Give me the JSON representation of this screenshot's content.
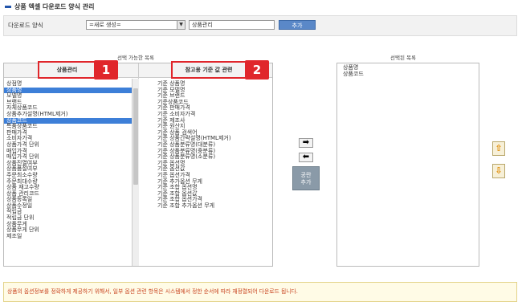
{
  "page": {
    "title": "상품 엑셀 다운로드 양식 관리"
  },
  "form": {
    "label": "다운로드 양식",
    "select_value": "=새로 생성=",
    "name_value": "상품관리",
    "add_label": "추가"
  },
  "available": {
    "label": "선택 가능한 목록",
    "col1_header": "상품관리",
    "col2_header": "참고용 기준 값 관련",
    "col1_items": [
      "상점명",
      "상품명",
      "모델명",
      "브랜드",
      "자체상품코드",
      "상품추가설명(HTML제거)",
      "상품코드",
      "특품상품코드",
      "판매가격",
      "소비자가격",
      "상품가격 단위",
      "매입가격",
      "매입가격 단위",
      "상품진열여부",
      "상품품절여부",
      "주문최소수량",
      "주문최대수량",
      "상품 재고수량",
      "상품 관리코드",
      "상품등록일",
      "상품수정일",
      "적립금",
      "적립금 단위",
      "상품무게",
      "상품무게 단위",
      "제조일"
    ],
    "col1_selected": [
      1,
      6
    ],
    "col2_items": [
      "기준 상품명",
      "기준 모델명",
      "기준 브랜드",
      "기준상품코드",
      "기준 판매가격",
      "기준 소비자가격",
      "기준 제조사",
      "기준 원산지",
      "기준 상품 검색어",
      "기준 상품간략설명(HTML제거)",
      "기준 상품분류명(대분류)",
      "기준 상품분류명(중분류)",
      "기준 상품분류명(소분류)",
      "기준 옵션명",
      "기준 옵션값",
      "기준 옵션가격",
      "기준 추가옵션 무게",
      "기준 조합 옵션명",
      "기준 조합 옵션값",
      "기준 조합 옵션가격",
      "기준 조합 추가옵션 무게"
    ]
  },
  "selected": {
    "label": "선택된 목록",
    "items": [
      "상품명",
      "상품코드"
    ]
  },
  "controls": {
    "move_right": "➡",
    "move_left": "⬅",
    "blank_add": [
      "공란",
      "추가"
    ],
    "move_up": "⇧",
    "move_down": "⇩"
  },
  "badges": {
    "first": "1",
    "second": "2"
  },
  "notice": "상품의 옵션정보를 정확하게 제공하기 위해서, 일부 옵션 관련 항목은 시스템에서 정한 순서에 따라 재정렬되어 다운로드 됩니다.",
  "colors": {
    "accent": "#2255aa",
    "selected_row": "#3d7fd8",
    "badge_red": "#e0262b",
    "notice_text": "#c8431f"
  }
}
